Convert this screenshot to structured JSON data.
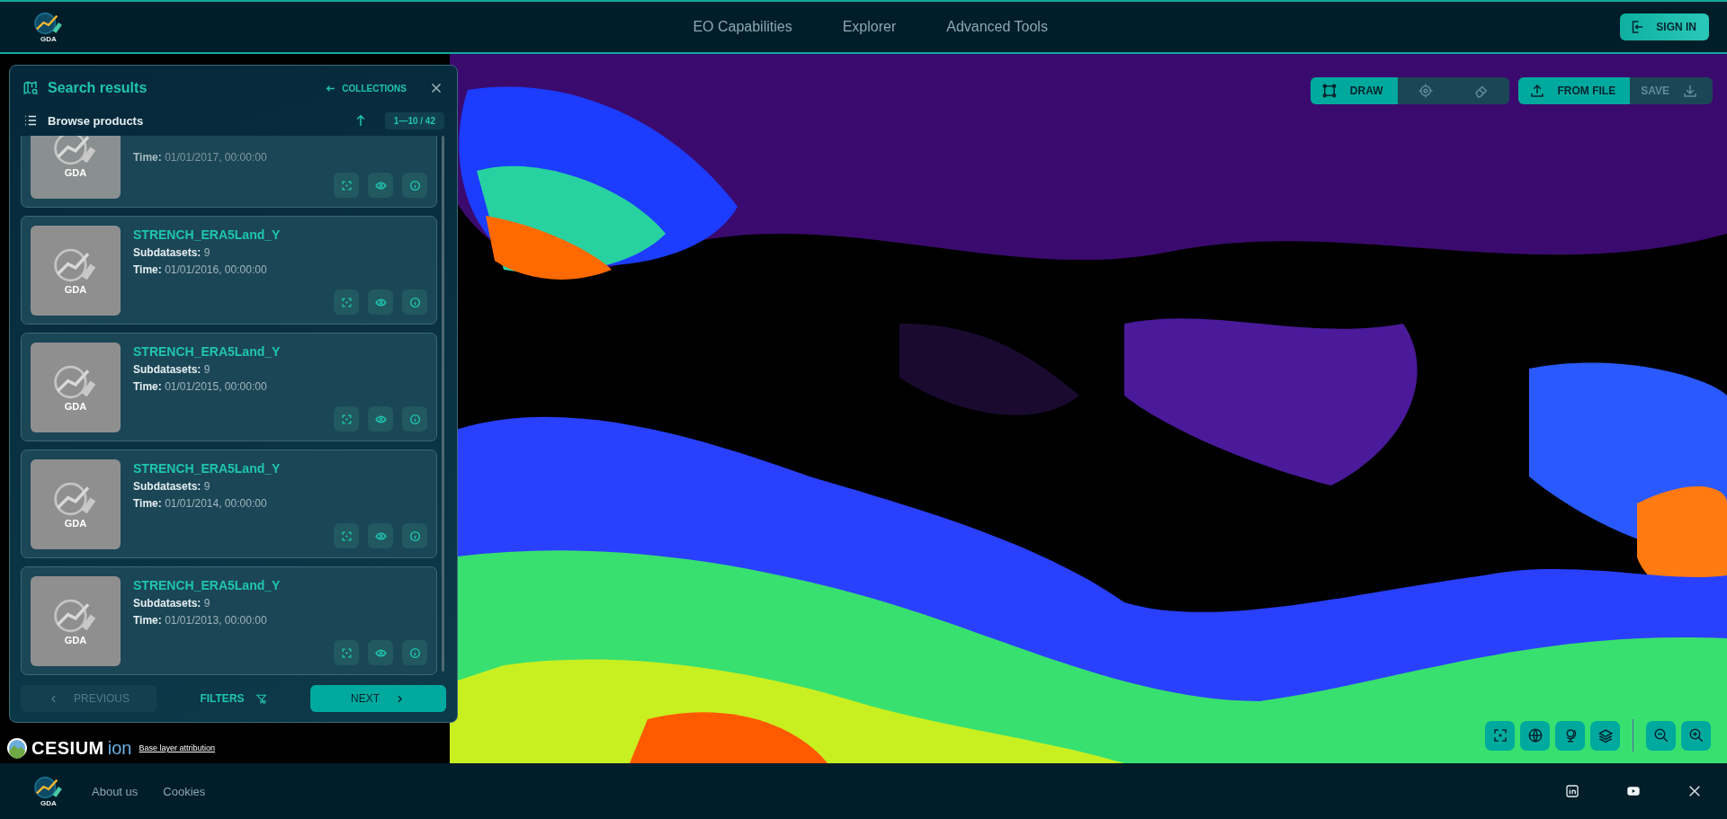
{
  "header": {
    "logo_text": "GDA",
    "nav": [
      {
        "label": "EO Capabilities"
      },
      {
        "label": "Explorer"
      },
      {
        "label": "Advanced Tools"
      }
    ],
    "sign_in": "SIGN IN"
  },
  "map": {
    "kind": "picture",
    "draw_tools": {
      "draw_label": "DRAW",
      "draw_selected": true,
      "from_file_label": "FROM FILE",
      "save_label": "SAVE",
      "save_disabled": true
    },
    "attribution": {
      "brand": "CESIUM",
      "brand_suffix": "ion",
      "link": "Base layer attribution"
    }
  },
  "panel": {
    "title": "Search results",
    "back_link": "COLLECTIONS",
    "subtitle": "Browse products",
    "range": "1—10 / 42",
    "products": [
      {
        "kind": "partial",
        "thumb_label": "GDA",
        "time_label": "Time:",
        "time": "01/01/2017, 00:00:00"
      },
      {
        "kind": "full",
        "thumb_label": "GDA",
        "name": "STRENCH_ERA5Land_Y",
        "subdatasets_label": "Subdatasets:",
        "subdatasets": "9",
        "time_label": "Time:",
        "time": "01/01/2016, 00:00:00"
      },
      {
        "kind": "full",
        "thumb_label": "GDA",
        "name": "STRENCH_ERA5Land_Y",
        "subdatasets_label": "Subdatasets:",
        "subdatasets": "9",
        "time_label": "Time:",
        "time": "01/01/2015, 00:00:00"
      },
      {
        "kind": "full",
        "thumb_label": "GDA",
        "name": "STRENCH_ERA5Land_Y",
        "subdatasets_label": "Subdatasets:",
        "subdatasets": "9",
        "time_label": "Time:",
        "time": "01/01/2014, 00:00:00"
      },
      {
        "kind": "full",
        "thumb_label": "GDA",
        "name": "STRENCH_ERA5Land_Y",
        "subdatasets_label": "Subdatasets:",
        "subdatasets": "9",
        "time_label": "Time:",
        "time": "01/01/2013, 00:00:00"
      }
    ],
    "previous": {
      "label": "PREVIOUS",
      "disabled": true
    },
    "filters": "FILTERS",
    "next": {
      "label": "NEXT",
      "disabled": false
    }
  },
  "footer": {
    "logo_text": "GDA",
    "links": [
      "About us",
      "Cookies"
    ]
  }
}
